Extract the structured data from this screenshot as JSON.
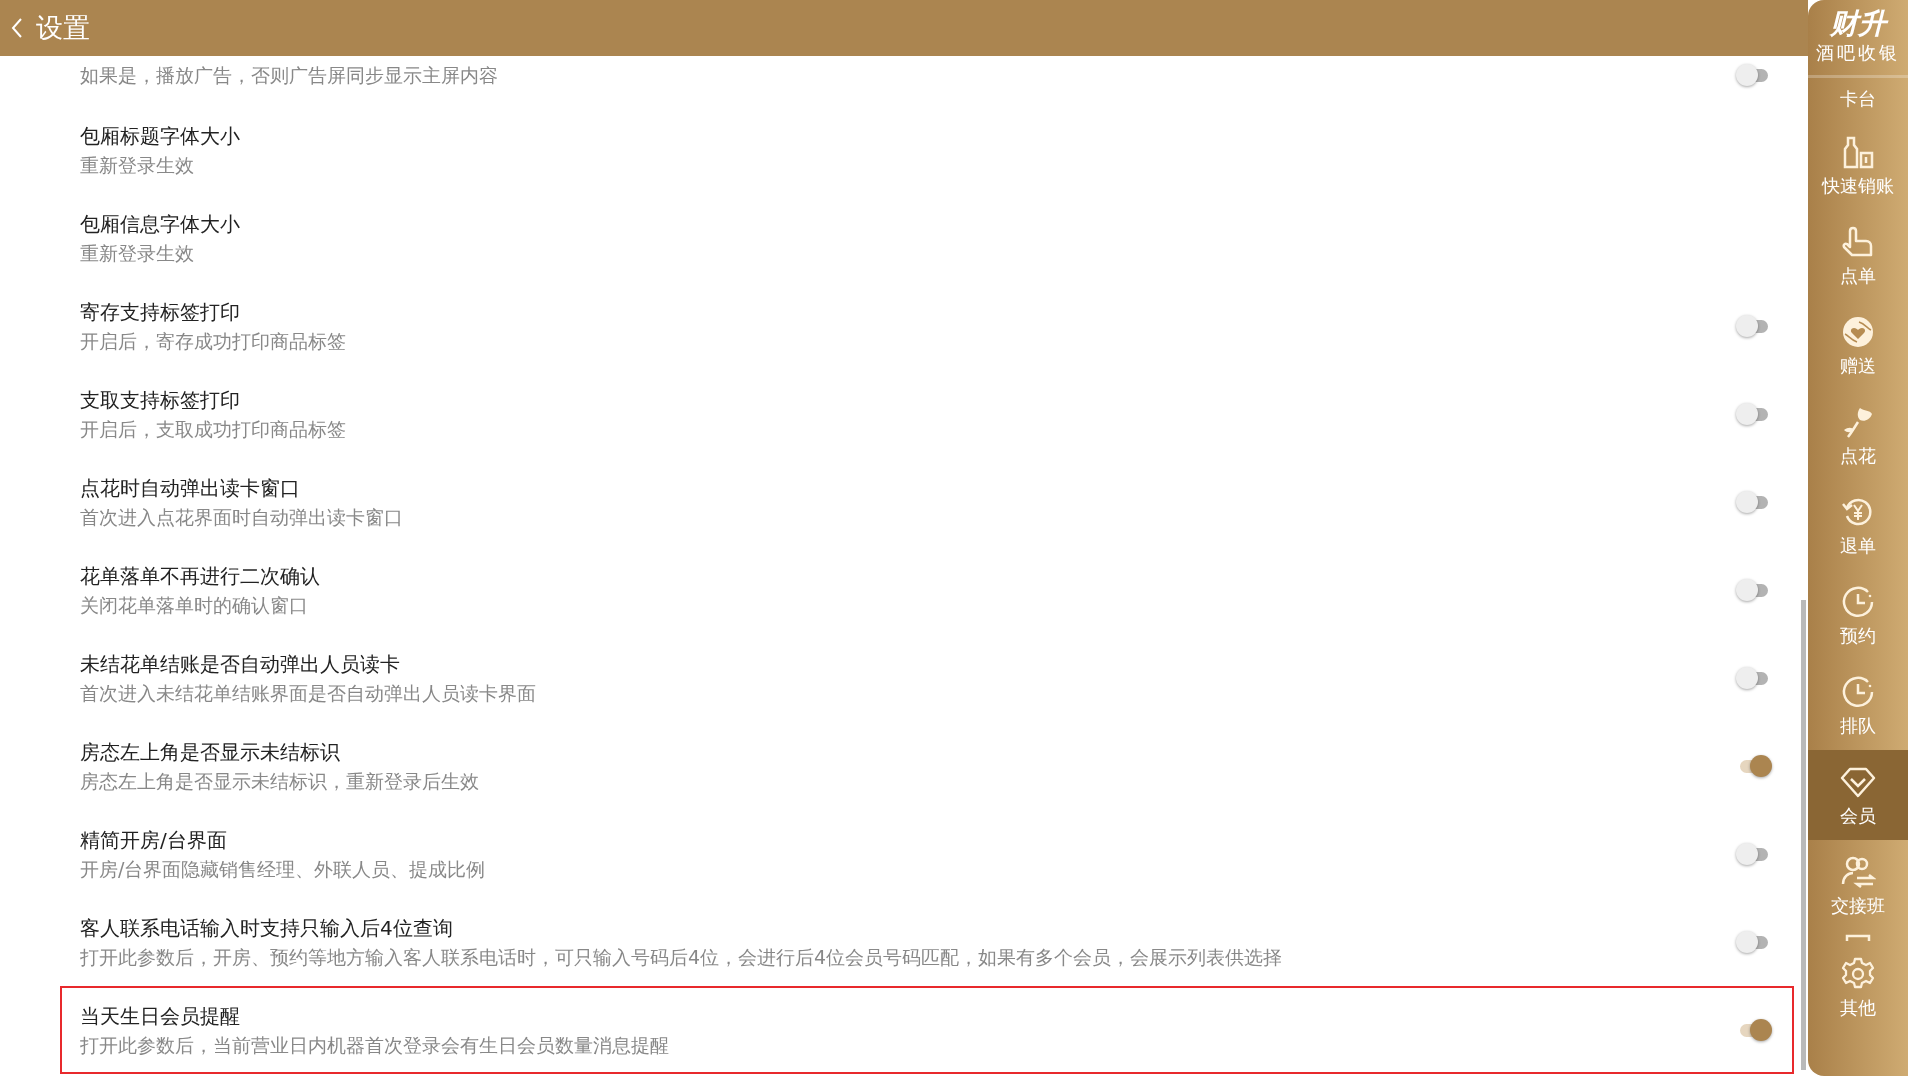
{
  "header": {
    "title": "设置"
  },
  "settings": [
    {
      "description": "如果是，播放广告，否则广告屏同步显示主屏内容",
      "kind": "toggle",
      "on": false
    },
    {
      "title": "包厢标题字体大小",
      "description": "重新登录生效",
      "kind": "plain"
    },
    {
      "title": "包厢信息字体大小",
      "description": "重新登录生效",
      "kind": "plain"
    },
    {
      "title": "寄存支持标签打印",
      "description": "开启后，寄存成功打印商品标签",
      "kind": "toggle",
      "on": false
    },
    {
      "title": "支取支持标签打印",
      "description": "开启后，支取成功打印商品标签",
      "kind": "toggle",
      "on": false
    },
    {
      "title": "点花时自动弹出读卡窗口",
      "description": "首次进入点花界面时自动弹出读卡窗口",
      "kind": "toggle",
      "on": false
    },
    {
      "title": "花单落单不再进行二次确认",
      "description": "关闭花单落单时的确认窗口",
      "kind": "toggle",
      "on": false
    },
    {
      "title": "未结花单结账是否自动弹出人员读卡",
      "description": "首次进入未结花单结账界面是否自动弹出人员读卡界面",
      "kind": "toggle",
      "on": false
    },
    {
      "title": "房态左上角是否显示未结标识",
      "description": "房态左上角是否显示未结标识，重新登录后生效",
      "kind": "toggle",
      "on": true
    },
    {
      "title": "精简开房/台界面",
      "description": "开房/台界面隐藏销售经理、外联人员、提成比例",
      "kind": "toggle",
      "on": false
    },
    {
      "title": "客人联系电话输入时支持只输入后4位查询",
      "description": "打开此参数后，开房、预约等地方输入客人联系电话时，可只输入号码后4位，会进行后4位会员号码匹配，如果有多个会员，会展示列表供选择",
      "kind": "toggle",
      "on": false
    },
    {
      "title": "当天生日会员提醒",
      "description": "打开此参数后，当前营业日内机器首次登录会有生日会员数量消息提醒",
      "kind": "toggle",
      "on": true,
      "highlighted": true
    }
  ],
  "sidebar": {
    "brand": "财升",
    "subtitle": "酒吧收银",
    "items": [
      {
        "label": "卡台",
        "selected": false
      },
      {
        "label": "快速销账",
        "selected": false
      },
      {
        "label": "点单",
        "selected": false
      },
      {
        "label": "赠送",
        "selected": false
      },
      {
        "label": "点花",
        "selected": false
      },
      {
        "label": "退单",
        "selected": false
      },
      {
        "label": "预约",
        "selected": false
      },
      {
        "label": "排队",
        "selected": false
      },
      {
        "label": "会员",
        "selected": true
      },
      {
        "label": "交接班",
        "selected": false
      },
      {
        "label": "其他",
        "selected": false
      }
    ]
  }
}
